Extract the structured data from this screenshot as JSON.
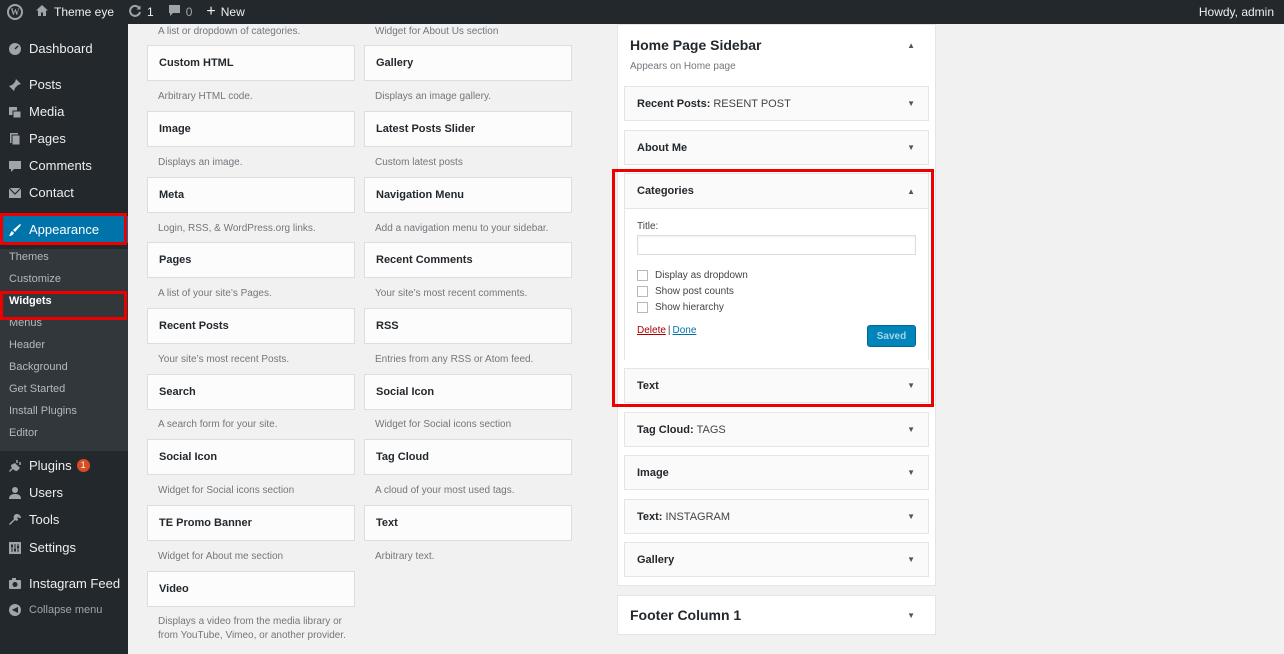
{
  "adminbar": {
    "site_name": "Theme eye",
    "updates_count": "1",
    "comments_count": "0",
    "new_label": "New",
    "howdy": "Howdy, admin"
  },
  "menu": {
    "dashboard": "Dashboard",
    "posts": "Posts",
    "media": "Media",
    "pages": "Pages",
    "comments": "Comments",
    "contact": "Contact",
    "appearance": "Appearance",
    "plugins": "Plugins",
    "plugins_badge": "1",
    "users": "Users",
    "tools": "Tools",
    "settings": "Settings",
    "instagram_feed": "Instagram Feed",
    "collapse": "Collapse menu",
    "submenu": [
      "Themes",
      "Customize",
      "Widgets",
      "Menus",
      "Header",
      "Background",
      "Get Started",
      "Install Plugins",
      "Editor"
    ]
  },
  "available_widgets": {
    "left_top_desc": "A list or dropdown of categories.",
    "right_top_desc": "Widget for About Us section",
    "left": [
      {
        "name": "Custom HTML",
        "desc": "Arbitrary HTML code."
      },
      {
        "name": "Image",
        "desc": "Displays an image."
      },
      {
        "name": "Meta",
        "desc": "Login, RSS, & WordPress.org links."
      },
      {
        "name": "Pages",
        "desc": "A list of your site’s Pages."
      },
      {
        "name": "Recent Posts",
        "desc": "Your site’s most recent Posts."
      },
      {
        "name": "Search",
        "desc": "A search form for your site."
      },
      {
        "name": "Social Icon",
        "desc": "Widget for Social icons section"
      },
      {
        "name": "TE Promo Banner",
        "desc": "Widget for About me section"
      },
      {
        "name": "Video",
        "desc": "Displays a video from the media library or from YouTube, Vimeo, or another provider."
      }
    ],
    "right": [
      {
        "name": "Gallery",
        "desc": "Displays an image gallery."
      },
      {
        "name": "Latest Posts Slider",
        "desc": "Custom latest posts"
      },
      {
        "name": "Navigation Menu",
        "desc": "Add a navigation menu to your sidebar."
      },
      {
        "name": "Recent Comments",
        "desc": "Your site’s most recent comments."
      },
      {
        "name": "RSS",
        "desc": "Entries from any RSS or Atom feed."
      },
      {
        "name": "Social Icon",
        "desc": "Widget for Social icons section"
      },
      {
        "name": "Tag Cloud",
        "desc": "A cloud of your most used tags."
      },
      {
        "name": "Text",
        "desc": "Arbitrary text."
      }
    ]
  },
  "home_sidebar": {
    "title": "Home Page Sidebar",
    "desc": "Appears on Home page",
    "widgets": [
      {
        "name": "Recent Posts:",
        "instance": "RESENT POST"
      },
      {
        "name": "About Me",
        "instance": ""
      }
    ],
    "categories": {
      "name": "Categories",
      "title_label": "Title:",
      "title_value": "",
      "options": [
        "Display as dropdown",
        "Show post counts",
        "Show hierarchy"
      ],
      "delete_label": "Delete",
      "separator": "|",
      "done_label": "Done",
      "saved_label": "Saved"
    },
    "widgets_after": [
      {
        "name": "Text",
        "instance": ""
      },
      {
        "name": "Tag Cloud:",
        "instance": "TAGS"
      },
      {
        "name": "Image",
        "instance": ""
      },
      {
        "name": "Text:",
        "instance": "INSTAGRAM"
      },
      {
        "name": "Gallery",
        "instance": ""
      }
    ]
  },
  "footer_sidebar": {
    "title": "Footer Column 1"
  },
  "colors": {
    "highlight": "#e00000",
    "accent": "#0073aa",
    "menu_bg": "#23282d"
  }
}
